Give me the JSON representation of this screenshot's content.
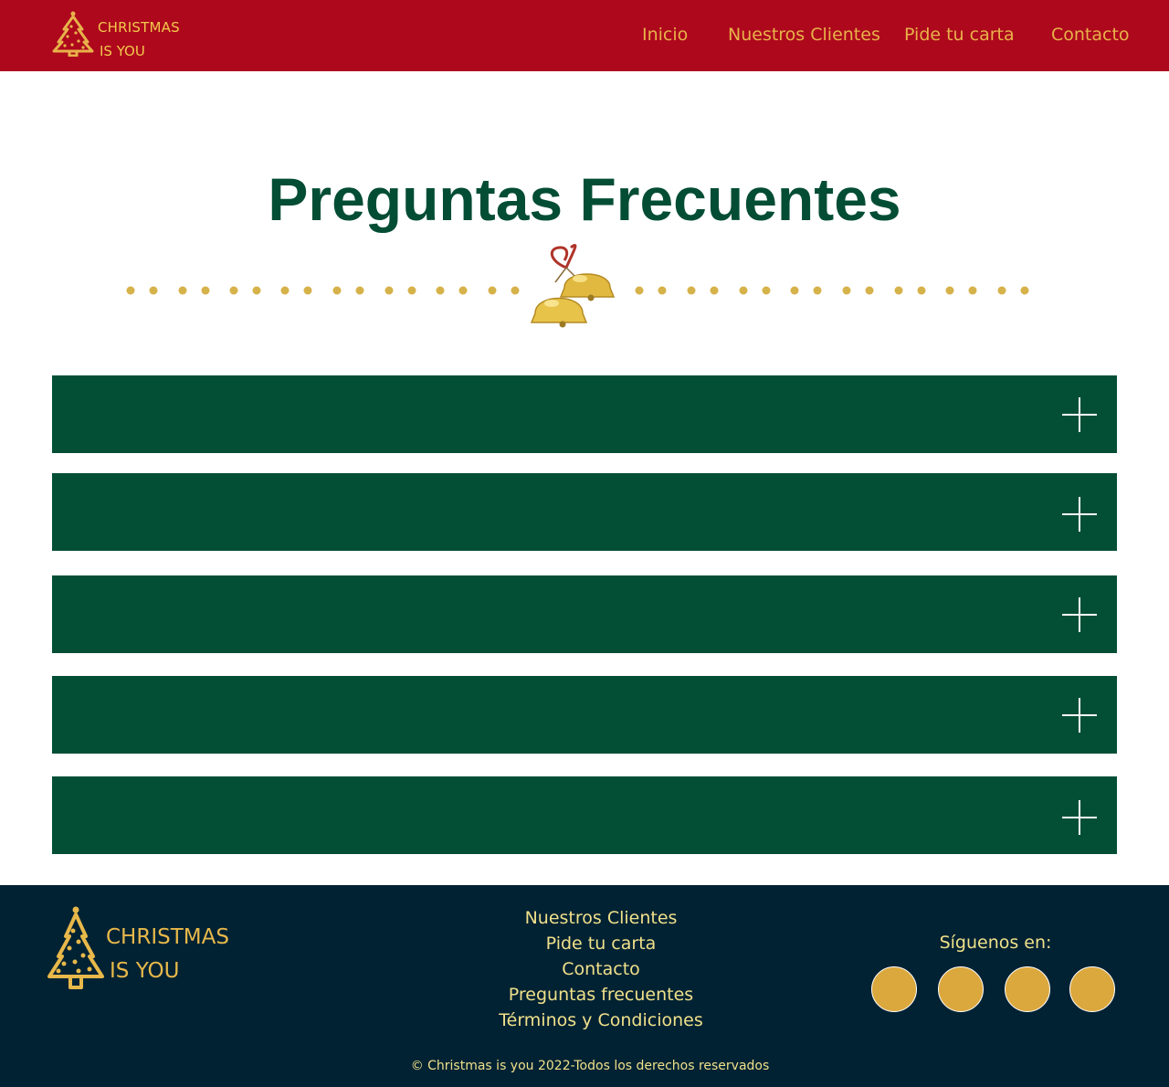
{
  "brand": {
    "line1": "CHRISTMAS",
    "line2": "IS YOU"
  },
  "nav": {
    "items": [
      "Inicio",
      "Nuestros Clientes",
      "Pide tu carta",
      "Contacto"
    ]
  },
  "main": {
    "title": "Preguntas Frecuentes",
    "faq_count": 5
  },
  "footer": {
    "brand_line1": "CHRISTMAS",
    "brand_line2": "IS YOU",
    "links": [
      "Nuestros Clientes",
      "Pide tu carta",
      "Contacto",
      "Preguntas frecuentes",
      "Términos y Condiciones"
    ],
    "follow_label": "Síguenos en:",
    "copyright": "© Christmas is you 2022-Todos los derechos reservados"
  },
  "colors": {
    "header_bg": "#ae081c",
    "nav_text": "#e8b24a",
    "title": "#044d35",
    "faq_bg": "#034f36",
    "footer_bg": "#002233",
    "gold": "#dba83e"
  },
  "icons": {
    "logo": "christmas-tree-icon",
    "divider": "bells-icon",
    "faq_toggle": "plus-icon",
    "social": "social-circle-icon"
  }
}
